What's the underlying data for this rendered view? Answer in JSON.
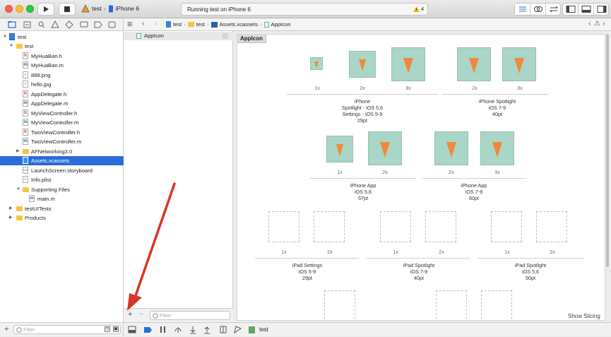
{
  "toolbar": {
    "scheme_name": "test",
    "device": "iPhone 6",
    "status": "Running test on iPhone 6",
    "warnings": "4"
  },
  "navigator": {
    "items": [
      {
        "label": "test",
        "kind": "project"
      },
      {
        "label": "test",
        "kind": "folder"
      },
      {
        "label": "MyHuaBan.h",
        "kind": "h"
      },
      {
        "label": "MyHuaBan.m",
        "kind": "m"
      },
      {
        "label": "888.png",
        "kind": "png"
      },
      {
        "label": "hello.jpg",
        "kind": "png"
      },
      {
        "label": "AppDelegate.h",
        "kind": "h"
      },
      {
        "label": "AppDelegate.m",
        "kind": "m"
      },
      {
        "label": "MyViewController.h",
        "kind": "h"
      },
      {
        "label": "MyViewController.m",
        "kind": "m"
      },
      {
        "label": "TwoViewController.h",
        "kind": "h"
      },
      {
        "label": "TwoViewController.m",
        "kind": "m"
      },
      {
        "label": "AFNetworking3.0",
        "kind": "folder"
      },
      {
        "label": "Assets.xcassets",
        "kind": "assets"
      },
      {
        "label": "LaunchScreen.storyboard",
        "kind": "sb"
      },
      {
        "label": "Info.plist",
        "kind": "plist"
      },
      {
        "label": "Supporting Files",
        "kind": "folder"
      },
      {
        "label": "main.m",
        "kind": "m"
      },
      {
        "label": "testUITests",
        "kind": "folder"
      },
      {
        "label": "Products",
        "kind": "folder"
      }
    ],
    "filter_placeholder": "Filter"
  },
  "jumpbar": {
    "crumbs": [
      "test",
      "test",
      "Assets.xcassets",
      "AppIcon"
    ]
  },
  "assets": {
    "items": [
      "AppIcon"
    ],
    "filter_placeholder": "Filter"
  },
  "canvas": {
    "title": "AppIcon",
    "show_slicing": "Show Slicing",
    "groups": [
      {
        "scales": [
          "1x",
          "2x",
          "3x"
        ],
        "lines": [
          "iPhone",
          "Spotlight - iOS 5,6",
          "Settings - iOS 5-9",
          "29pt"
        ]
      },
      {
        "scales": [
          "2x",
          "3x"
        ],
        "lines": [
          "iPhone Spotlight",
          "iOS 7-9",
          "40pt"
        ]
      },
      {
        "scales": [
          "1x",
          "2x"
        ],
        "lines": [
          "iPhone App",
          "iOS 5,6",
          "57pt"
        ]
      },
      {
        "scales": [
          "2x",
          "3x"
        ],
        "lines": [
          "iPhone App",
          "iOS 7-9",
          "60pt"
        ]
      },
      {
        "scales": [
          "1x",
          "2x"
        ],
        "lines": [
          "iPad Settings",
          "iOS 5-9",
          "29pt"
        ]
      },
      {
        "scales": [
          "1x",
          "2x"
        ],
        "lines": [
          "iPad Spotlight",
          "iOS 7-9",
          "40pt"
        ]
      },
      {
        "scales": [
          "1x",
          "2x"
        ],
        "lines": [
          "iPad Spotlight",
          "iOS 5,6",
          "50pt"
        ]
      }
    ]
  },
  "bottombar": {
    "target": "test"
  },
  "colors": {
    "selection": "#2b6dd8",
    "icon_bg": "#a9d6c6",
    "carrot": "#f08a3a",
    "annotation_arrow": "#d9352b"
  }
}
